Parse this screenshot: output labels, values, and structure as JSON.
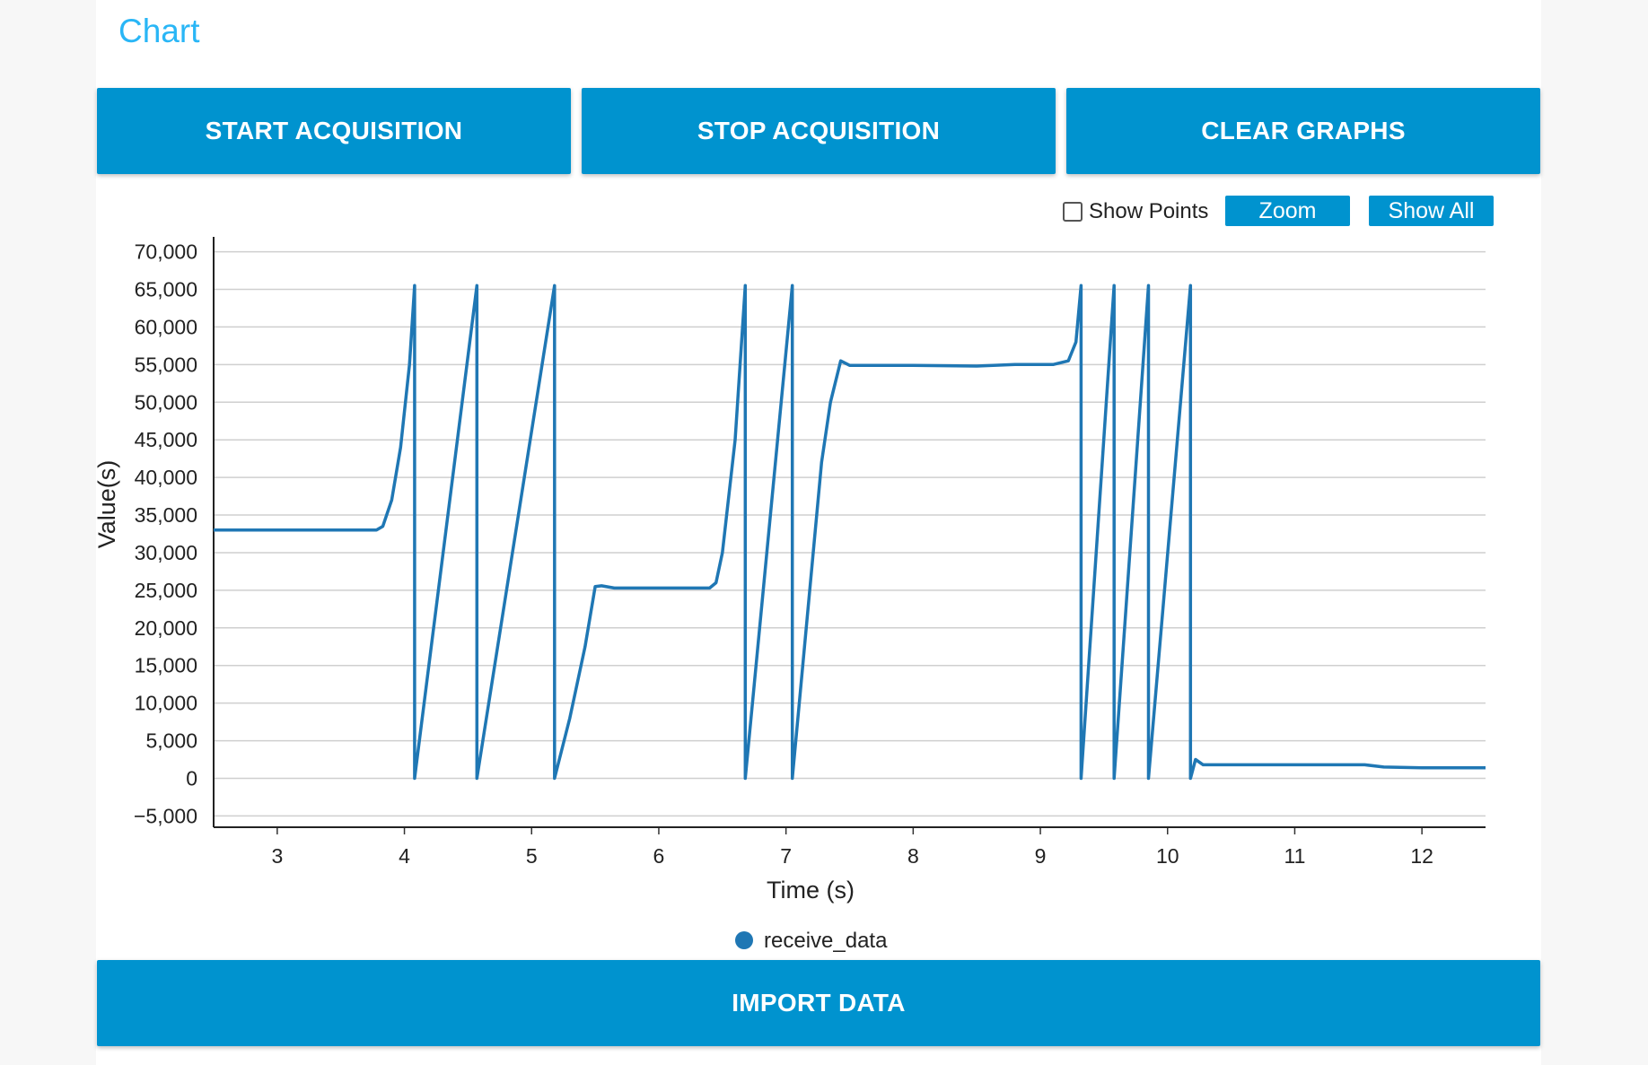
{
  "page_title": "Chart",
  "buttons": {
    "start": "START ACQUISITION",
    "stop": "STOP ACQUISITION",
    "clear": "CLEAR GRAPHS",
    "import": "IMPORT DATA"
  },
  "chart_controls": {
    "show_points_label": "Show Points",
    "show_points_checked": false,
    "zoom_label": "Zoom",
    "show_all_label": "Show All"
  },
  "colors": {
    "accent": "#0093cf",
    "title": "#29b6f6",
    "series": "#1f77b4"
  },
  "chart_data": {
    "type": "line",
    "xlabel": "Time (s)",
    "ylabel": "Value(s)",
    "xlim": [
      2.5,
      12.5
    ],
    "ylim": [
      -6500,
      71500
    ],
    "x_ticks": [
      3,
      4,
      5,
      6,
      7,
      8,
      9,
      10,
      11,
      12
    ],
    "x_tick_labels": [
      "3",
      "4",
      "5",
      "6",
      "7",
      "8",
      "9",
      "10",
      "11",
      "12"
    ],
    "y_ticks": [
      -5000,
      0,
      5000,
      10000,
      15000,
      20000,
      25000,
      30000,
      35000,
      40000,
      45000,
      50000,
      55000,
      60000,
      65000,
      70000
    ],
    "y_tick_labels": [
      "−5,000",
      "0",
      "5,000",
      "10,000",
      "15,000",
      "20,000",
      "25,000",
      "30,000",
      "35,000",
      "40,000",
      "45,000",
      "50,000",
      "55,000",
      "60,000",
      "65,000",
      "70,000"
    ],
    "grid": true,
    "legend_position": "bottom-center",
    "series": [
      {
        "name": "receive_data",
        "x": [
          2.5,
          3.78,
          3.83,
          3.9,
          3.97,
          4.04,
          4.08,
          4.08,
          4.57,
          4.57,
          5.18,
          5.18,
          5.3,
          5.42,
          5.5,
          5.55,
          5.65,
          6.0,
          6.4,
          6.45,
          6.5,
          6.6,
          6.68,
          6.68,
          7.05,
          7.05,
          7.28,
          7.35,
          7.43,
          7.5,
          8.0,
          8.5,
          8.8,
          9.1,
          9.22,
          9.28,
          9.32,
          9.32,
          9.58,
          9.58,
          9.85,
          9.85,
          10.18,
          10.18,
          10.22,
          10.28,
          10.5,
          11.0,
          11.55,
          11.7,
          12.0,
          12.5
        ],
        "y": [
          33000,
          33000,
          33500,
          37000,
          44000,
          55000,
          65500,
          0,
          65500,
          0,
          65500,
          0,
          8000,
          17500,
          25500,
          25600,
          25300,
          25300,
          25300,
          26000,
          30000,
          45000,
          65500,
          0,
          65500,
          0,
          42000,
          50000,
          55500,
          54900,
          54900,
          54800,
          55000,
          55000,
          55500,
          58000,
          65500,
          0,
          65500,
          0,
          65500,
          0,
          65500,
          0,
          2500,
          1800,
          1800,
          1800,
          1800,
          1500,
          1400,
          1400
        ]
      }
    ]
  }
}
